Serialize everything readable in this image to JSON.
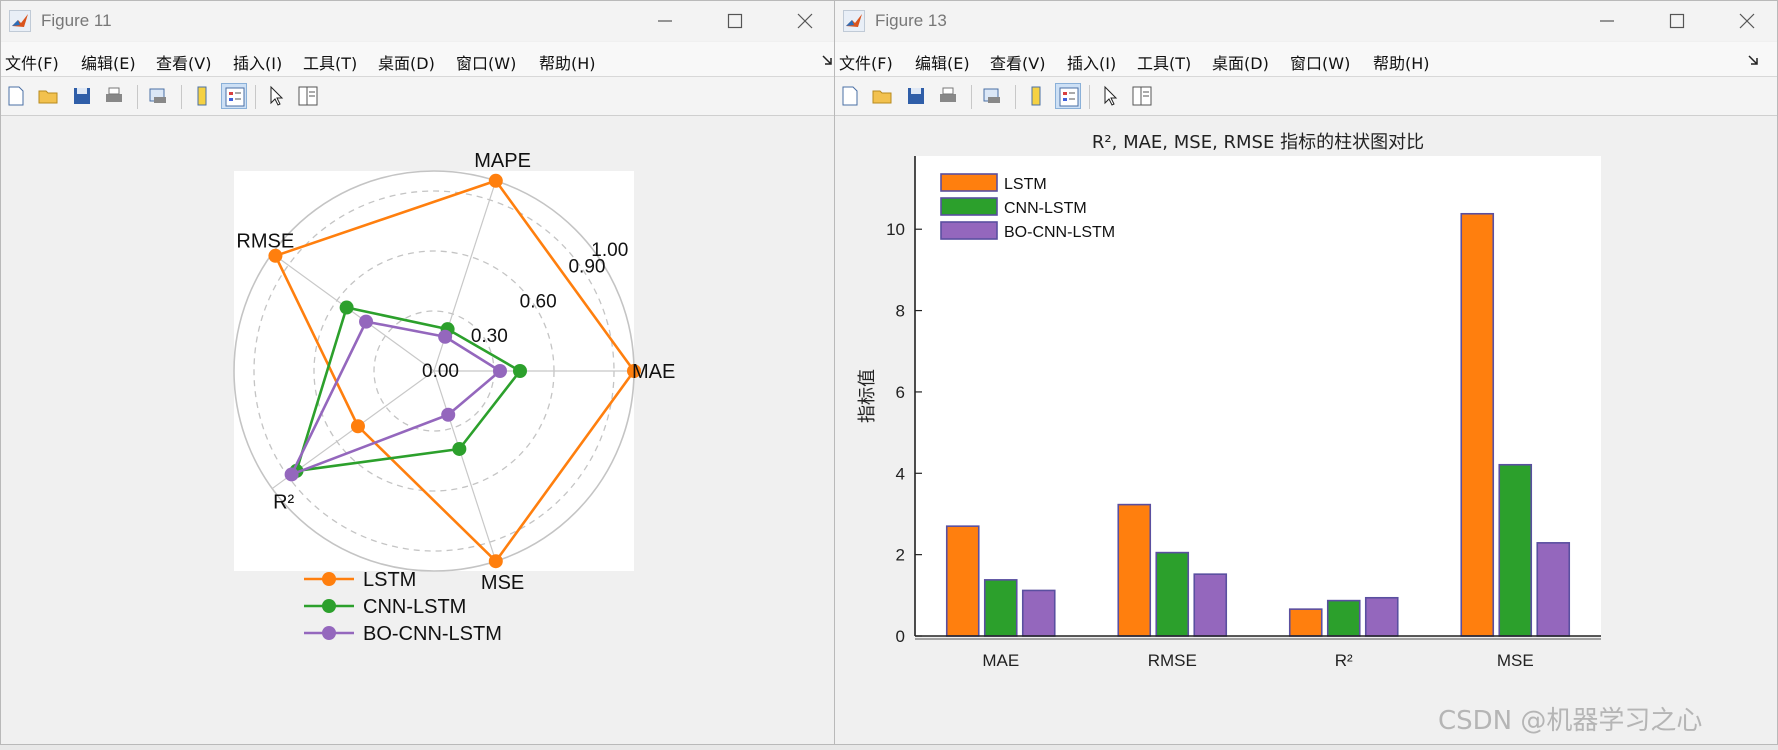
{
  "windows": [
    {
      "title": "Figure 11",
      "menu": [
        "文件(F)",
        "编辑(E)",
        "查看(V)",
        "插入(I)",
        "工具(T)",
        "桌面(D)",
        "窗口(W)",
        "帮助(H)"
      ]
    },
    {
      "title": "Figure 13",
      "menu": [
        "文件(F)",
        "编辑(E)",
        "查看(V)",
        "插入(I)",
        "工具(T)",
        "桌面(D)",
        "窗口(W)",
        "帮助(H)"
      ]
    }
  ],
  "toolbar_icons": [
    "new-file-icon",
    "open-folder-icon",
    "save-icon",
    "print-icon",
    "print-preview-icon",
    "colorbar-icon",
    "legend-icon",
    "pointer-icon",
    "property-inspector-icon"
  ],
  "colors": {
    "LSTM": "#ff7f0e",
    "CNN-LSTM": "#2ca02c",
    "BO-CNN-LSTM": "#9467bd",
    "bar_edge": "#5a4fa0"
  },
  "watermark": "CSDN @机器学习之心",
  "chart_data": [
    {
      "type": "radar",
      "axes": [
        "MAE",
        "MAPE",
        "RMSE",
        "R²",
        "MSE"
      ],
      "radial_ticks": [
        "0.00",
        "0.30",
        "0.60",
        "0.90",
        "1.00"
      ],
      "rlim": [
        0,
        1
      ],
      "grid": true,
      "legend_position": "bottom",
      "series": [
        {
          "name": "LSTM",
          "values": [
            1.0,
            1.0,
            0.98,
            0.47,
            1.0
          ]
        },
        {
          "name": "CNN-LSTM",
          "values": [
            0.43,
            0.22,
            0.54,
            0.85,
            0.41
          ]
        },
        {
          "name": "BO-CNN-LSTM",
          "values": [
            0.33,
            0.18,
            0.42,
            0.88,
            0.23
          ]
        }
      ]
    },
    {
      "type": "bar",
      "title": "R², MAE, MSE, RMSE 指标的柱状图对比",
      "categories": [
        "MAE",
        "RMSE",
        "R²",
        "MSE"
      ],
      "ylabel": "指标值",
      "ylim": [
        0,
        11.8
      ],
      "yticks": [
        0,
        2,
        4,
        6,
        8,
        10
      ],
      "grid": false,
      "legend_position": "top-left",
      "series": [
        {
          "name": "LSTM",
          "values": [
            2.7,
            3.23,
            0.66,
            10.38
          ]
        },
        {
          "name": "CNN-LSTM",
          "values": [
            1.38,
            2.05,
            0.87,
            4.21
          ]
        },
        {
          "name": "BO-CNN-LSTM",
          "values": [
            1.12,
            1.52,
            0.94,
            2.29
          ]
        }
      ]
    }
  ]
}
